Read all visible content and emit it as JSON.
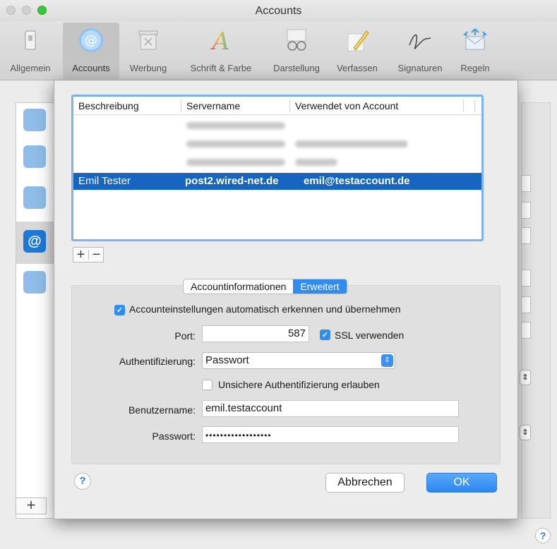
{
  "window": {
    "title": "Accounts"
  },
  "toolbar": {
    "items": [
      {
        "label": "Allgemein",
        "icon": "switch-icon"
      },
      {
        "label": "Accounts",
        "icon": "at-icon",
        "active": true
      },
      {
        "label": "Werbung",
        "icon": "trash-icon"
      },
      {
        "label": "Schrift & Farbe",
        "icon": "font-color-icon"
      },
      {
        "label": "Darstellung",
        "icon": "glasses-icon"
      },
      {
        "label": "Verfassen",
        "icon": "pencil-icon"
      },
      {
        "label": "Signaturen",
        "icon": "signature-icon"
      },
      {
        "label": "Regeln",
        "icon": "envelope-arrows-icon"
      }
    ]
  },
  "sidebar": {
    "add_label": "+"
  },
  "accounts_table": {
    "headers": [
      "Beschreibung",
      "Servername",
      "Verwendet von Account"
    ],
    "selected": {
      "description": "Emil Tester",
      "server": "post2.wired-net.de",
      "account": "emil@testaccount.de"
    },
    "add_label": "+",
    "remove_label": "−"
  },
  "tabs": {
    "info": "Accountinformationen",
    "advanced": "Erweitert"
  },
  "settings": {
    "auto_detect_label": "Accounteinstellungen automatisch erkennen und übernehmen",
    "port_label": "Port:",
    "port_value": "587",
    "ssl_label": "SSL verwenden",
    "auth_label": "Authentifizierung:",
    "auth_value": "Passwort",
    "insecure_label": "Unsichere Authentifizierung erlauben",
    "username_label": "Benutzername:",
    "username_value": "emil.testaccount",
    "password_label": "Passwort:",
    "password_value": "••••••••••••••••••"
  },
  "buttons": {
    "help": "?",
    "cancel": "Abbrechen",
    "ok": "OK"
  },
  "colors": {
    "accent": "#2f8cf0",
    "selection": "#1665c1"
  }
}
